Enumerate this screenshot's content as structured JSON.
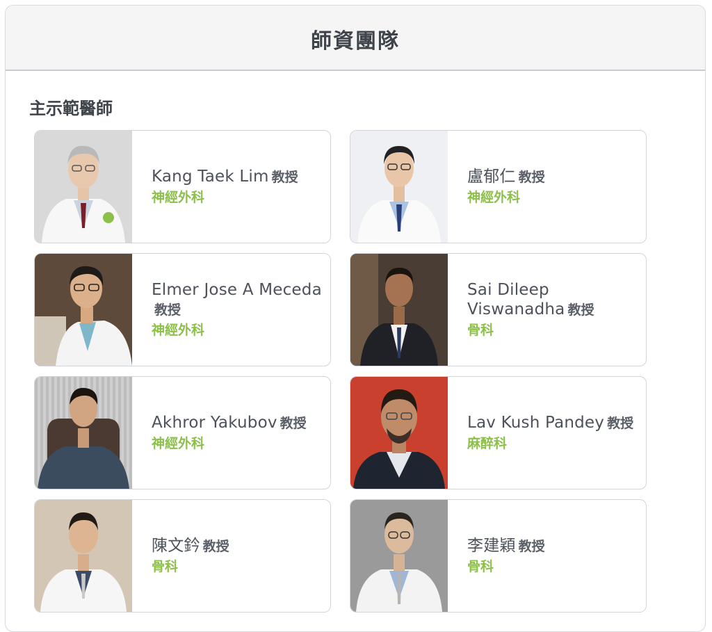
{
  "panel": {
    "title": "師資團隊"
  },
  "section": {
    "title": "主示範醫師"
  },
  "doctors": [
    {
      "name": "Kang Taek Lim",
      "rank": "教授",
      "dept": "神經外科"
    },
    {
      "name": "盧郁仁",
      "rank": "教授",
      "dept": "神經外科"
    },
    {
      "name": "Elmer Jose A Meceda",
      "rank": "教授",
      "dept": "神經外科"
    },
    {
      "name": "Sai Dileep Viswanadha",
      "rank": "教授",
      "dept": "骨科"
    },
    {
      "name": "Akhror Yakubov",
      "rank": "教授",
      "dept": "神經外科"
    },
    {
      "name": "Lav Kush Pandey",
      "rank": "教授",
      "dept": "麻醉科"
    },
    {
      "name": "陳文鈐",
      "rank": "教授",
      "dept": "骨科"
    },
    {
      "name": "李建穎",
      "rank": "教授",
      "dept": "骨科"
    }
  ],
  "colors": {
    "accent": "#8cc04b",
    "text": "#4a4e55",
    "border": "#d3d4da"
  }
}
